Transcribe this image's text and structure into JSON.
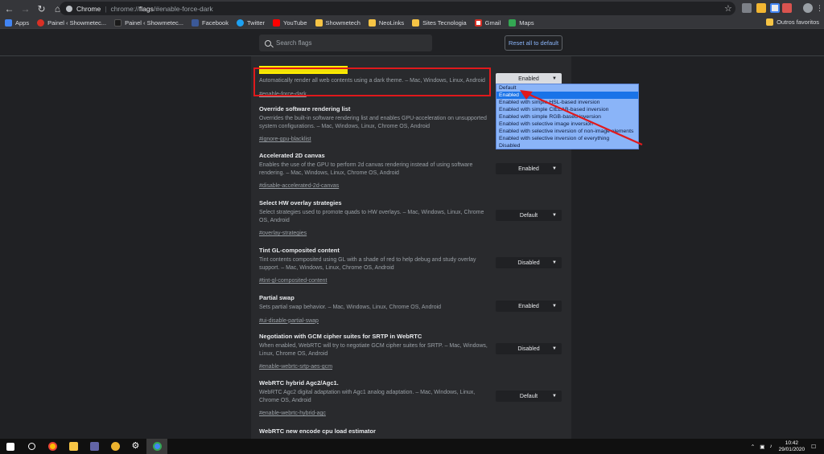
{
  "browser": {
    "site": "Chrome",
    "url_prefix": "chrome://",
    "url_bold": "flags",
    "url_suffix": "/#enable-force-dark"
  },
  "bookmarks": {
    "items": [
      "Apps",
      "Painel ‹ Showmetec...",
      "Painel ‹ Showmetec...",
      "Facebook",
      "Twitter",
      "YouTube",
      "Showmetech",
      "NeoLinks",
      "Sites Tecnologia",
      "Gmail",
      "Maps"
    ],
    "other": "Outros favoritos"
  },
  "header": {
    "search_placeholder": "Search flags",
    "reset_label": "Reset all to default"
  },
  "flags": [
    {
      "title": "",
      "desc": "Automatically render all web contents using a dark theme. – Mac, Windows, Linux, Android",
      "link": "#enable-force-dark",
      "value": "Enabled"
    },
    {
      "title": "Override software rendering list",
      "desc": "Overrides the built-in software rendering list and enables GPU-acceleration on unsupported system configurations. – Mac, Windows, Linux, Chrome OS, Android",
      "link": "#ignore-gpu-blacklist",
      "value": ""
    },
    {
      "title": "Accelerated 2D canvas",
      "desc": "Enables the use of the GPU to perform 2d canvas rendering instead of using software rendering. – Mac, Windows, Linux, Chrome OS, Android",
      "link": "#disable-accelerated-2d-canvas",
      "value": "Enabled"
    },
    {
      "title": "Select HW overlay strategies",
      "desc": "Select strategies used to promote quads to HW overlays. – Mac, Windows, Linux, Chrome OS, Android",
      "link": "#overlay-strategies",
      "value": "Default"
    },
    {
      "title": "Tint GL-composited content",
      "desc": "Tint contents composited using GL with a shade of red to help debug and study overlay support. – Mac, Windows, Linux, Chrome OS, Android",
      "link": "#tint-gl-composited-content",
      "value": "Disabled"
    },
    {
      "title": "Partial swap",
      "desc": "Sets partial swap behavior. – Mac, Windows, Linux, Chrome OS, Android",
      "link": "#ui-disable-partial-swap",
      "value": "Enabled"
    },
    {
      "title": "Negotiation with GCM cipher suites for SRTP in WebRTC",
      "desc": "When enabled, WebRTC will try to negotiate GCM cipher suites for SRTP. – Mac, Windows, Linux, Chrome OS, Android",
      "link": "#enable-webrtc-srtp-aes-gcm",
      "value": "Disabled"
    },
    {
      "title": "WebRTC hybrid Agc2/Agc1.",
      "desc": "WebRTC Agc2 digital adaptation with Agc1 analog adaptation. – Mac, Windows, Linux, Chrome OS, Android",
      "link": "#enable-webrtc-hybrid-agc",
      "value": "Default"
    },
    {
      "title": "WebRTC new encode cpu load estimator",
      "desc": "",
      "link": "",
      "value": ""
    }
  ],
  "dropdown_options": [
    "Default",
    "Enabled",
    "Enabled with simple HSL-based inversion",
    "Enabled with simple CIELAB-based inversion",
    "Enabled with simple RGB-based inversion",
    "Enabled with selective image inversion",
    "Enabled with selective inversion of non-image elements",
    "Enabled with selective inversion of everything",
    "Disabled"
  ],
  "dropdown_selected_index": 1,
  "taskbar": {
    "time": "10:42",
    "date": "29/01/2020"
  },
  "colors": {
    "highlight": "#f2e205",
    "annotation_red": "#e0191c",
    "dropdown_bg": "#8ab4f8",
    "dropdown_selected": "#1a73e8"
  }
}
